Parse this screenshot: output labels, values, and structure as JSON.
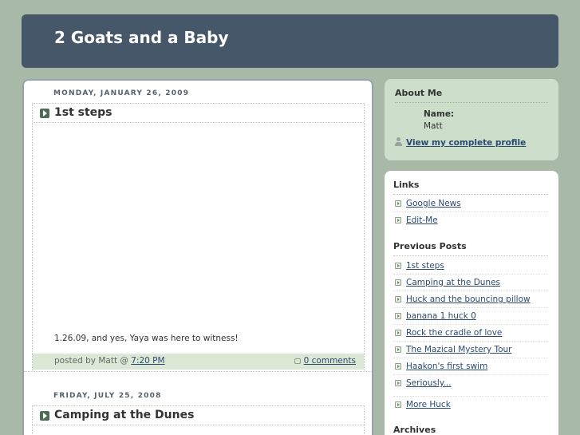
{
  "blog": {
    "title": "2 Goats and a Baby"
  },
  "posts": [
    {
      "date": "MONDAY, JANUARY 26, 2009",
      "title": "1st steps",
      "body": "1.26.09, and yes, Yaya was here to witness!",
      "byline_prefix": "posted by Matt @ ",
      "time": "7:20 PM",
      "comments": "0 comments"
    },
    {
      "date": "FRIDAY, JULY 25, 2008",
      "title": "Camping at the Dunes"
    }
  ],
  "about": {
    "heading": "About Me",
    "name_label": "Name:",
    "name_value": "Matt",
    "profile_link": "View my complete profile"
  },
  "links": {
    "heading": "Links",
    "items": [
      "Google News",
      "Edit-Me"
    ]
  },
  "previous_posts": {
    "heading": "Previous Posts",
    "items": [
      "1st steps",
      "Camping at the Dunes",
      "Huck and the bouncing pillow",
      "banana 1 huck 0",
      "Rock the cradle of love",
      "The Mazical Mystery Tour",
      "Haakon's first swim",
      "Seriously...",
      "More Huck"
    ]
  },
  "archives": {
    "heading": "Archives"
  },
  "icons": {
    "post_title": "arrow-right-icon",
    "list_bullet": "arrow-bullet-icon",
    "comment": "comment-icon",
    "profile": "person-icon"
  },
  "colors": {
    "page_bg": "#a9b9a7",
    "header_bg": "#47576a",
    "about_bg": "#cddfcb",
    "footer_bg": "#dce8d6",
    "link": "#2b4a70"
  }
}
